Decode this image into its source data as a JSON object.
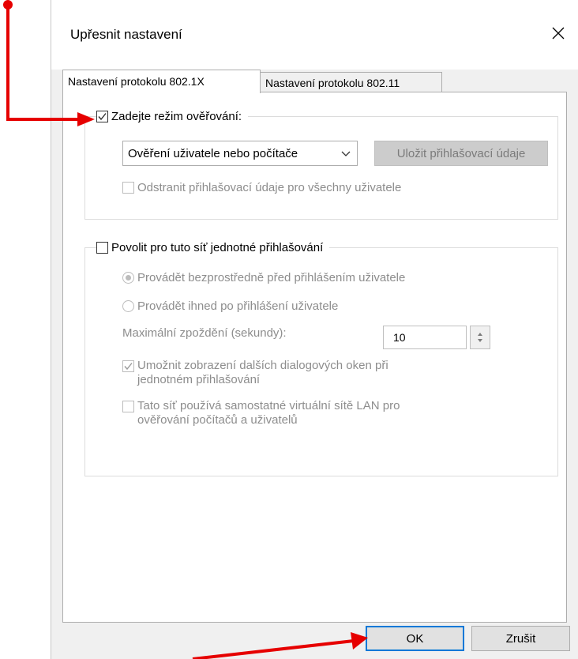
{
  "dialog": {
    "title": "Upřesnit nastavení"
  },
  "tabs": [
    {
      "label": "Nastavení protokolu 802.1X",
      "active": true
    },
    {
      "label": "Nastavení protokolu 802.11",
      "active": false
    }
  ],
  "auth_group": {
    "checkbox_label": "Zadejte režim ověřování:",
    "checked": true,
    "mode_select_value": "Ověření uživatele nebo počítače",
    "save_credentials_label": "Uložit přihlašovací údaje",
    "remove_credentials_label": "Odstranit přihlašovací údaje pro všechny uživatele",
    "remove_credentials_checked": false
  },
  "sso_group": {
    "checkbox_label": "Povolit pro tuto síť jednotné přihlašování",
    "checked": false,
    "radio_before_label": "Provádět bezprostředně před přihlášením uživatele",
    "radio_before_selected": true,
    "radio_after_label": "Provádět ihned po přihlášení uživatele",
    "radio_after_selected": false,
    "max_delay_label": "Maximální zpoždění (sekundy):",
    "max_delay_value": "10",
    "allow_dialogs_label_line1": "Umožnit zobrazení dalších dialogových oken při",
    "allow_dialogs_label_line2": "jednotném přihlašování",
    "allow_dialogs_checked": true,
    "vlan_label_line1": "Tato síť používá samostatné virtuální sítě LAN pro",
    "vlan_label_line2": "ověřování počítačů a uživatelů",
    "vlan_checked": false
  },
  "footer": {
    "ok_label": "OK",
    "cancel_label": "Zrušit"
  },
  "colors": {
    "annotation_arrow": "#e60000",
    "default_button_border": "#0078d7",
    "disabled_text": "#8d8d8d"
  }
}
